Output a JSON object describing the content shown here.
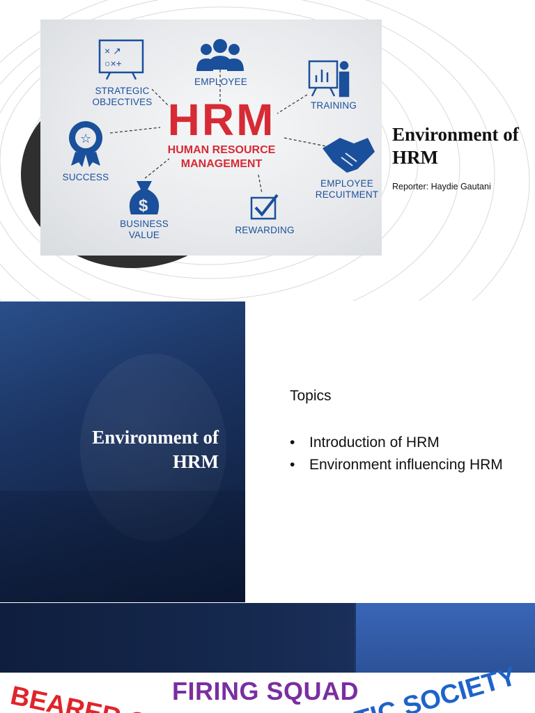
{
  "slide1": {
    "image": {
      "big_title": "HRM",
      "subtitle_line1": "HUMAN RESOURCE",
      "subtitle_line2": "MANAGEMENT",
      "labels": {
        "strategic_line1": "STRATEGIC",
        "strategic_line2": "OBJECTIVES",
        "employee": "EMPLOYEE",
        "training": "TRAINING",
        "success": "SUCCESS",
        "recruitment_line1": "EMPLOYEE",
        "recruitment_line2": "RECUITMENT",
        "business_line1": "BUSINESS",
        "business_line2": "VALUE",
        "rewarding": "REWARDING"
      },
      "colors": {
        "red": "#d62b35",
        "blue": "#1a4f9c"
      }
    },
    "title": "Environment of HRM",
    "reporter": "Reporter: Haydie Gautani"
  },
  "slide2": {
    "title_line1": "Environment of",
    "title_line2": "HRM",
    "topics_heading": "Topics",
    "bullets": [
      "Introduction of HRM",
      "Environment influencing HRM"
    ]
  },
  "slide3": {
    "firing_squad": "FIRING SQUAD",
    "bearer": "BEARER OF",
    "society": "TIC SOCIETY"
  }
}
